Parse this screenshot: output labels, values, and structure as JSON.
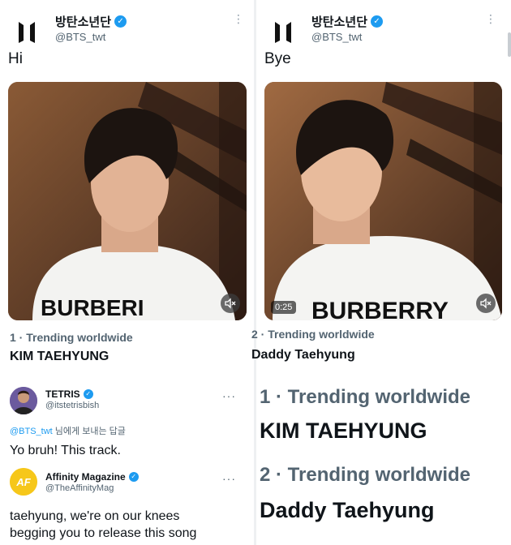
{
  "tweet_left": {
    "display_name": "방탄소년단",
    "handle": "@BTS_twt",
    "text": "Hi",
    "trend_rank": "1 · Trending worldwide",
    "trend_name": "KIM TAEHYUNG"
  },
  "tweet_right": {
    "display_name": "방탄소년단",
    "handle": "@BTS_twt",
    "text": "Bye",
    "video_duration": "0:25",
    "trend_rank": "2 · Trending worldwide",
    "trend_name": "Daddy Taehyung"
  },
  "replies": [
    {
      "name": "TETRIS",
      "handle": "@itstetrisbish",
      "replying_mention": "@BTS_twt",
      "replying_suffix": " 님에게 보내는 답글",
      "text": "Yo bruh! This track."
    },
    {
      "name": "Affinity Magazine",
      "handle": "@TheAffinityMag",
      "avatar_text": "AF",
      "text_line1": "taehyung, we're on our knees",
      "text_line2": "begging you to release this song"
    }
  ],
  "zoom": {
    "rank1": "1 · Trending worldwide",
    "name1": "KIM TAEHYUNG",
    "rank2": "2 · Trending worldwide",
    "name2": "Daddy Taehyung"
  },
  "colors": {
    "verified_blue": "#1d9bf0",
    "text_primary": "#0f1419",
    "text_secondary": "#536471"
  },
  "icons": [
    "bts-logo-icon",
    "verified-icon",
    "more-vertical-icon",
    "mute-icon",
    "more-horizontal-icon"
  ]
}
